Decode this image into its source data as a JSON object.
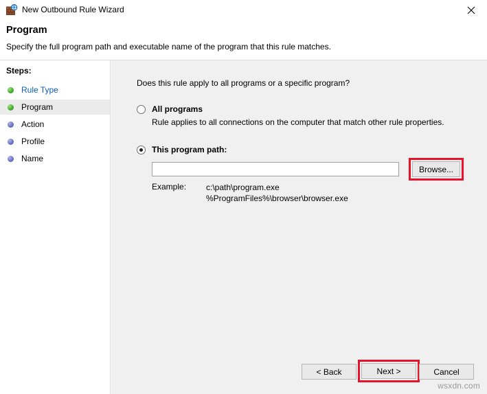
{
  "window": {
    "title": "New Outbound Rule Wizard",
    "icon": "firewall-globe-icon",
    "close_label": "✕"
  },
  "header": {
    "title": "Program",
    "subtitle": "Specify the full program path and executable name of the program that this rule matches."
  },
  "sidebar": {
    "heading": "Steps:",
    "items": [
      {
        "label": "Rule Type",
        "state": "completed",
        "bullet": "green",
        "style": "link",
        "active": false
      },
      {
        "label": "Program",
        "state": "current",
        "bullet": "green",
        "style": "plain",
        "active": true
      },
      {
        "label": "Action",
        "state": "pending",
        "bullet": "blue",
        "style": "plain",
        "active": false
      },
      {
        "label": "Profile",
        "state": "pending",
        "bullet": "blue",
        "style": "plain",
        "active": false
      },
      {
        "label": "Name",
        "state": "pending",
        "bullet": "blue",
        "style": "plain",
        "active": false
      }
    ]
  },
  "main": {
    "question": "Does this rule apply to all programs or a specific program?",
    "options": [
      {
        "id": "all-programs",
        "title": "All programs",
        "description": "Rule applies to all connections on the computer that match other rule properties.",
        "selected": false
      },
      {
        "id": "this-program-path",
        "title": "This program path:",
        "selected": true
      }
    ],
    "path_input": {
      "value": "",
      "placeholder": ""
    },
    "browse_button": {
      "label": "Browse...",
      "highlight_color": "#e8122b"
    },
    "example": {
      "label": "Example:",
      "lines": [
        "c:\\path\\program.exe",
        "%ProgramFiles%\\browser\\browser.exe"
      ]
    }
  },
  "footer": {
    "back_label": "< Back",
    "next_label": "Next >",
    "cancel_label": "Cancel",
    "next_highlight_color": "#e8122b"
  },
  "watermark": "wsxdn.com"
}
